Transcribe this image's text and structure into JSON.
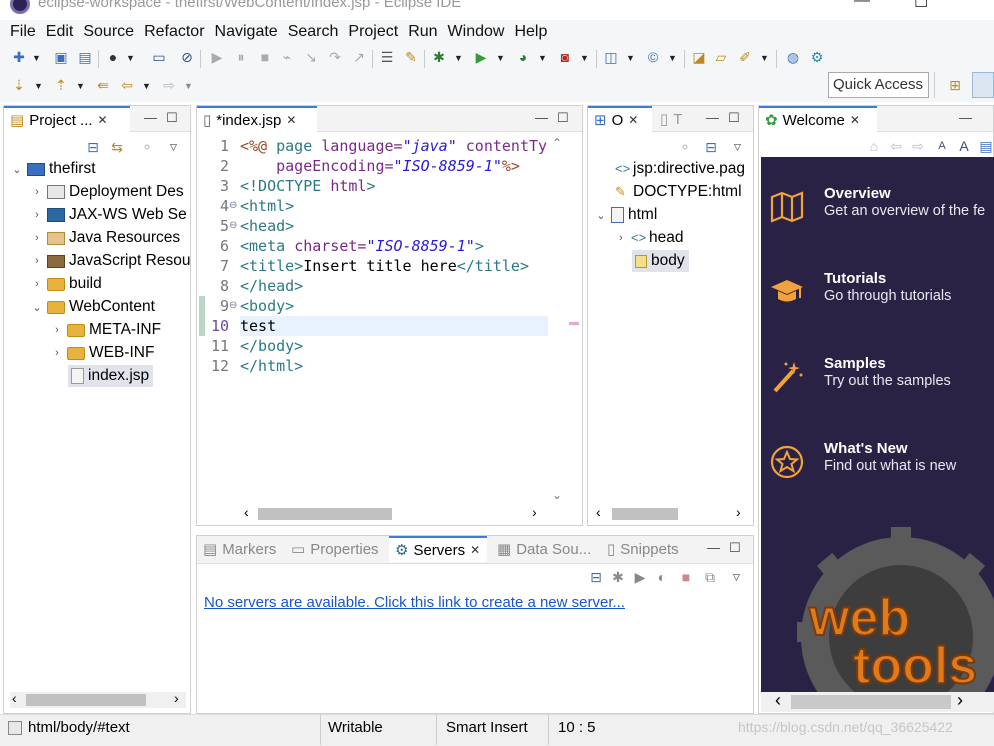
{
  "window": {
    "title": "eclipse-workspace - thefirst/WebContent/index.jsp - Eclipse IDE",
    "minimize": "—",
    "maximize": "☐"
  },
  "menu": [
    "File",
    "Edit",
    "Source",
    "Refactor",
    "Navigate",
    "Search",
    "Project",
    "Run",
    "Window",
    "Help"
  ],
  "quick_access": "Quick Access",
  "project_explorer": {
    "tab_label": "Project ...",
    "tree": [
      {
        "label": "thefirst",
        "level": 0,
        "expanded": true,
        "icon": "project-icon"
      },
      {
        "label": "Deployment Des",
        "level": 1,
        "expanded": false,
        "icon": "deployment-icon"
      },
      {
        "label": "JAX-WS Web Se",
        "level": 1,
        "expanded": false,
        "icon": "webservice-icon"
      },
      {
        "label": "Java Resources",
        "level": 1,
        "expanded": false,
        "icon": "java-resources-icon"
      },
      {
        "label": "JavaScript Resou",
        "level": 1,
        "expanded": false,
        "icon": "javascript-resources-icon"
      },
      {
        "label": "build",
        "level": 1,
        "expanded": false,
        "icon": "folder-icon"
      },
      {
        "label": "WebContent",
        "level": 1,
        "expanded": true,
        "icon": "folder-icon"
      },
      {
        "label": "META-INF",
        "level": 2,
        "expanded": false,
        "icon": "folder-icon"
      },
      {
        "label": "WEB-INF",
        "level": 2,
        "expanded": false,
        "icon": "folder-icon"
      },
      {
        "label": "index.jsp",
        "level": 2,
        "expanded": null,
        "icon": "file-icon",
        "selected": true
      }
    ]
  },
  "editor": {
    "tab_label": "*index.jsp",
    "line_numbers": [
      "1",
      "2",
      "3",
      "4",
      "5",
      "6",
      "7",
      "8",
      "9",
      "10",
      "11",
      "12"
    ],
    "lines": {
      "l1_a": "<%@ ",
      "l1_b": "page ",
      "l1_c": "language=",
      "l1_d": "\"java\"",
      "l1_e": " contentTy",
      "l2_a": "    pageEncoding=",
      "l2_b": "\"ISO-8859-1\"",
      "l2_c": "%>",
      "l3_a": "<!DOCTYPE ",
      "l3_b": "html",
      "l3_c": ">",
      "l4": "<html>",
      "l5": "<head>",
      "l6_a": "<meta ",
      "l6_b": "charset=",
      "l6_c": "\"ISO-8859-1\"",
      "l6_d": ">",
      "l7_a": "<title>",
      "l7_b": "Insert title here",
      "l7_c": "</title>",
      "l8": "</head>",
      "l9": "<body>",
      "l10": "test",
      "l11": "</body>",
      "l12": "</html>"
    }
  },
  "outline": {
    "tab_label": "O",
    "tab2_label": "T",
    "tree": [
      {
        "label": "jsp:directive.pag",
        "level": 0,
        "icon": "directive-icon"
      },
      {
        "label": "DOCTYPE:html",
        "level": 0,
        "icon": "doctype-icon"
      },
      {
        "label": "html",
        "level": 0,
        "expanded": true,
        "icon": "element-icon"
      },
      {
        "label": "head",
        "level": 1,
        "expanded": false,
        "icon": "element-icon"
      },
      {
        "label": "body",
        "level": 1,
        "icon": "element-icon",
        "selected": true
      }
    ]
  },
  "welcome": {
    "tab_label": "Welcome",
    "items": [
      {
        "title": "Overview",
        "desc": "Get an overview of the fe",
        "icon": "book-icon"
      },
      {
        "title": "Tutorials",
        "desc": "Go through tutorials",
        "icon": "graduation-cap-icon"
      },
      {
        "title": "Samples",
        "desc": "Try out the samples",
        "icon": "magic-wand-icon"
      },
      {
        "title": "What's New",
        "desc": "Find out what is new",
        "icon": "star-icon"
      }
    ],
    "logo_text": "web tools"
  },
  "bottom_panel": {
    "tabs": [
      "Markers",
      "Properties",
      "Servers",
      "Data Sou...",
      "Snippets"
    ],
    "active_tab": "Servers",
    "servers_link": "No servers are available. Click this link to create a new server..."
  },
  "status": {
    "path": "html/body/#text",
    "mode": "Writable",
    "insert": "Smart Insert",
    "position": "10 : 5",
    "watermark": "https://blog.csdn.net/qq_36625422"
  },
  "colors": {
    "tag": "#2a7a86",
    "attr": "#7a2a86",
    "string": "#2a1bd6",
    "welcome_bg": "#2a2244",
    "welcome_icon": "#f2a23a",
    "link": "#1a55c8"
  }
}
